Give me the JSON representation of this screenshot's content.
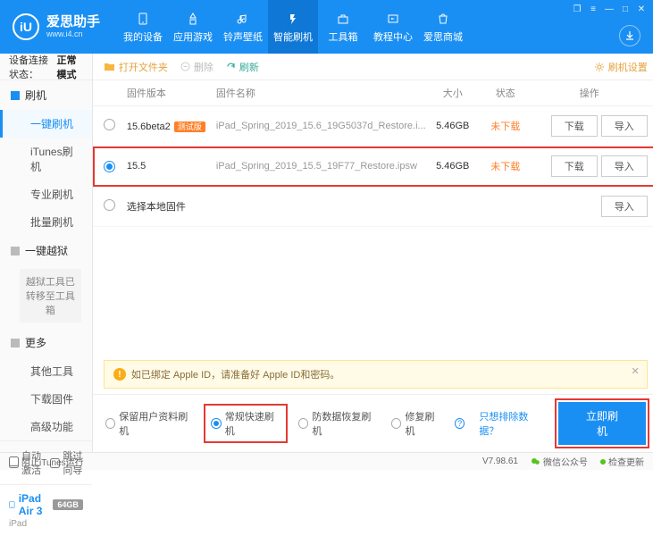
{
  "brand": {
    "cn": "爱思助手",
    "url": "www.i4.cn",
    "logo_letter": "iU"
  },
  "win_ctrl": [
    "❐",
    "≡",
    "—",
    "□",
    "✕"
  ],
  "nav": [
    {
      "label": "我的设备",
      "icon": "device-icon"
    },
    {
      "label": "应用游戏",
      "icon": "apps-icon"
    },
    {
      "label": "铃声壁纸",
      "icon": "music-icon"
    },
    {
      "label": "智能刷机",
      "icon": "flash-icon",
      "active": true
    },
    {
      "label": "工具箱",
      "icon": "toolbox-icon"
    },
    {
      "label": "教程中心",
      "icon": "tutorial-icon"
    },
    {
      "label": "爱思商城",
      "icon": "shop-icon"
    }
  ],
  "conn": {
    "label": "设备连接状态：",
    "status": "正常模式"
  },
  "sidebar": {
    "flash_head": "刷机",
    "flash_items": [
      "一键刷机",
      "iTunes刷机",
      "专业刷机",
      "批量刷机"
    ],
    "jail_head": "一键越狱",
    "jail_note": "越狱工具已转移至工具箱",
    "more_head": "更多",
    "more_items": [
      "其他工具",
      "下载固件",
      "高级功能"
    ],
    "checks": {
      "auto": "自动激活",
      "skip": "跳过向导"
    }
  },
  "device": {
    "name": "iPad Air 3",
    "cap": "64GB",
    "type": "iPad"
  },
  "toolbar": {
    "open": "打开文件夹",
    "del": "删除",
    "refresh": "刷新",
    "settings": "刷机设置"
  },
  "thead": {
    "ver": "固件版本",
    "name": "固件名称",
    "size": "大小",
    "stat": "状态",
    "ops": "操作"
  },
  "rows": [
    {
      "ver": "15.6beta2",
      "badge": "测试版",
      "name": "iPad_Spring_2019_15.6_19G5037d_Restore.i...",
      "size": "5.46GB",
      "stat": "未下载",
      "selected": false
    },
    {
      "ver": "15.5",
      "badge": "",
      "name": "iPad_Spring_2019_15.5_19F77_Restore.ipsw",
      "size": "5.46GB",
      "stat": "未下载",
      "selected": true
    }
  ],
  "local_row": "选择本地固件",
  "btn": {
    "download": "下载",
    "import": "导入"
  },
  "alert": "如已绑定 Apple ID，请准备好 Apple ID和密码。",
  "modes": {
    "keep": "保留用户资料刷机",
    "normal": "常规快速刷机",
    "recover": "防数据恢复刷机",
    "repair": "修复刷机",
    "exclude": "只想排除数据？"
  },
  "primary": "立即刷机",
  "footer": {
    "block": "阻止iTunes运行",
    "ver": "V7.98.61",
    "wechat": "微信公众号",
    "update": "检查更新"
  }
}
